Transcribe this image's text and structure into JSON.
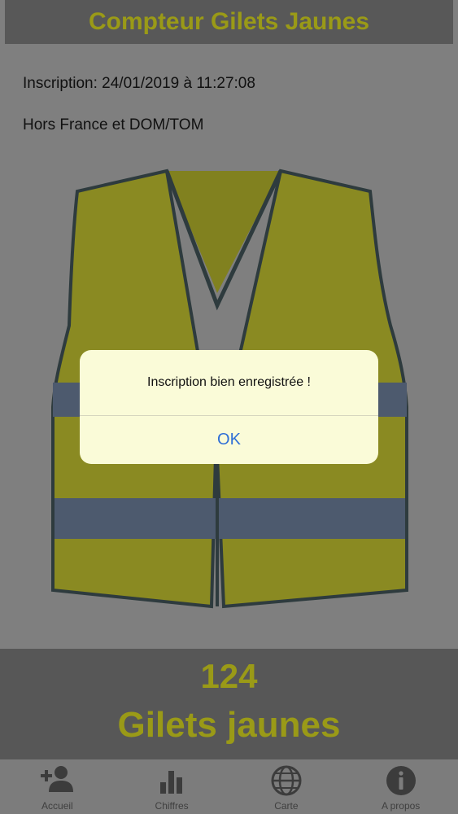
{
  "header": {
    "title": "Compteur Gilets Jaunes"
  },
  "info": {
    "inscription": "Inscription: 24/01/2019 à 11:27:08",
    "location": "Hors France et DOM/TOM"
  },
  "counter": {
    "count": "124",
    "label": "Gilets jaunes"
  },
  "dialog": {
    "message": "Inscription bien enregistrée !",
    "ok_label": "OK"
  },
  "tabs": [
    {
      "label": "Accueil",
      "icon": "add-user-icon"
    },
    {
      "label": "Chiffres",
      "icon": "bar-chart-icon"
    },
    {
      "label": "Carte",
      "icon": "globe-icon"
    },
    {
      "label": "A propos",
      "icon": "info-icon"
    }
  ],
  "colors": {
    "accent": "#9a9a17",
    "overlay_bg": "#7f7f7f",
    "panel_bg": "#575757",
    "vest": "#8a8a22",
    "vest_band": "#4d5a6e",
    "dialog_bg": "#fafbd8",
    "link": "#2f6fd6"
  }
}
